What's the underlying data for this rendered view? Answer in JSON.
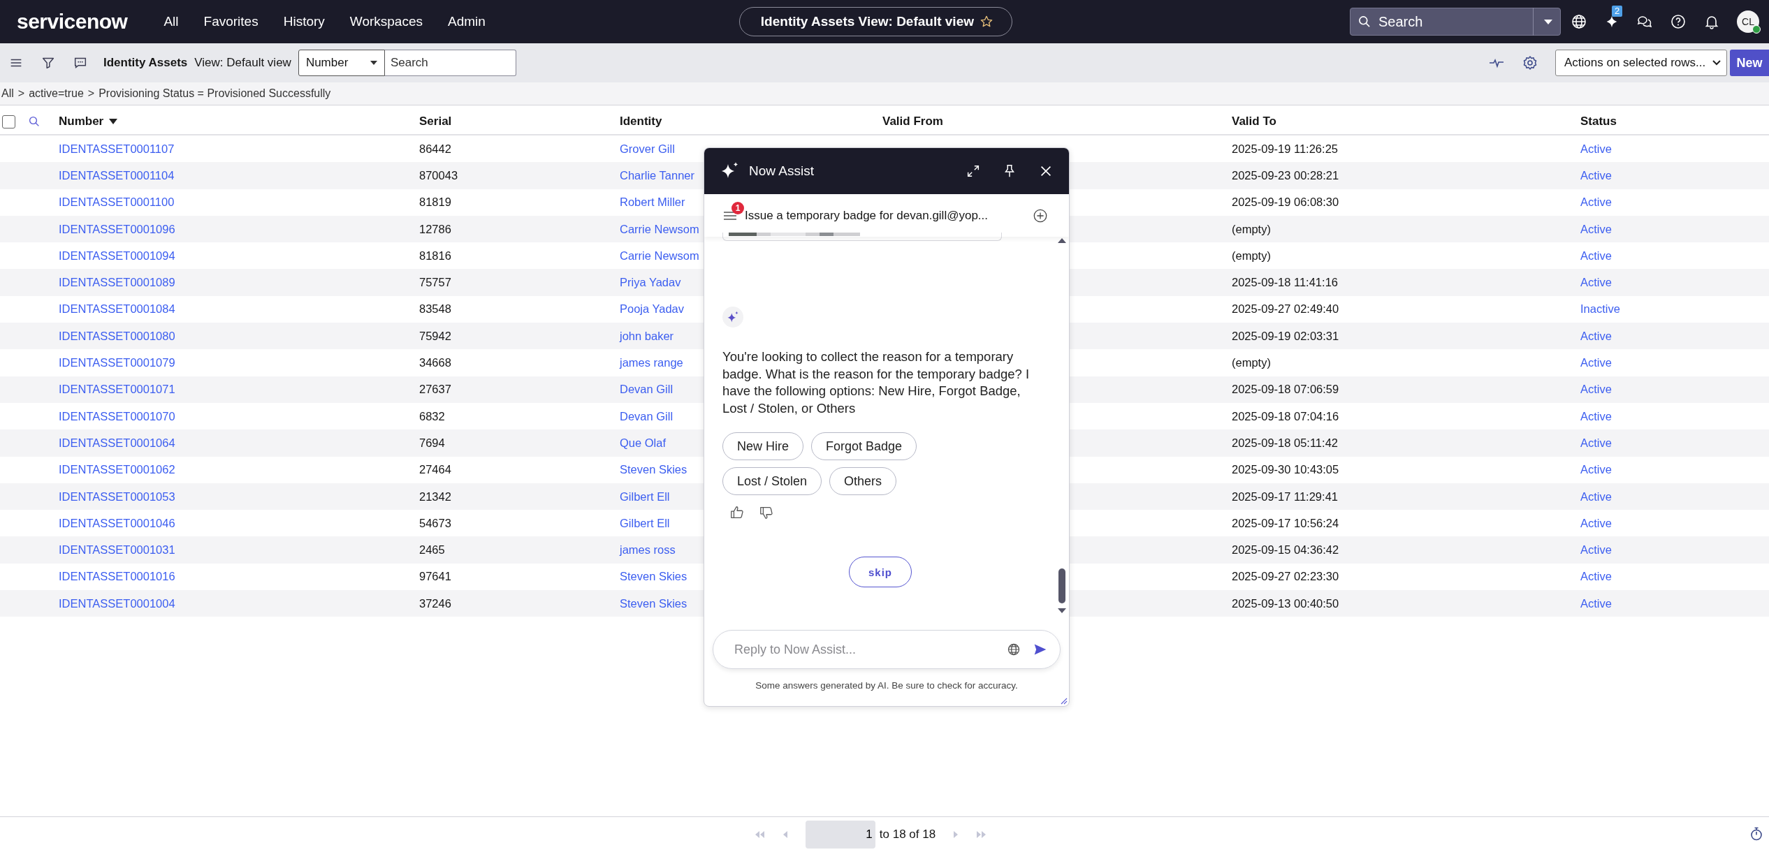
{
  "top_bar": {
    "logo": "servicenow",
    "nav": [
      "All",
      "Favorites",
      "History",
      "Workspaces",
      "Admin"
    ],
    "page_title": "Identity Assets View: Default view",
    "search": {
      "placeholder": "Search"
    },
    "assist_badge": "2",
    "avatar": "CL"
  },
  "list_toolbar": {
    "title": "Identity Assets",
    "view": "View: Default view",
    "field_select": "Number",
    "search": {
      "placeholder": "Search"
    },
    "actions_select": "Actions on selected rows...",
    "new_button": "New"
  },
  "breadcrumbs": {
    "separator": ">",
    "items": [
      "All",
      "active=true",
      "Provisioning Status = Provisioned Successfully"
    ]
  },
  "table": {
    "select_all_checked": false,
    "columns": [
      "Number",
      "Serial",
      "Identity",
      "Valid From",
      "Valid To",
      "Status"
    ],
    "rows": [
      {
        "number": "IDENTASSET0001107",
        "serial": "86442",
        "identity": "Grover Gill",
        "valid_to": "2025-09-19 11:26:25",
        "status": "Active"
      },
      {
        "number": "IDENTASSET0001104",
        "serial": "870043",
        "identity": "Charlie Tanner",
        "valid_to": "2025-09-23 00:28:21",
        "status": "Active"
      },
      {
        "number": "IDENTASSET0001100",
        "serial": "81819",
        "identity": "Robert Miller",
        "valid_to": "2025-09-19 06:08:30",
        "status": "Active"
      },
      {
        "number": "IDENTASSET0001096",
        "serial": "12786",
        "identity": "Carrie Newsom",
        "valid_to": "(empty)",
        "status": "Active"
      },
      {
        "number": "IDENTASSET0001094",
        "serial": "81816",
        "identity": "Carrie Newsom",
        "valid_to": "(empty)",
        "status": "Active"
      },
      {
        "number": "IDENTASSET0001089",
        "serial": "75757",
        "identity": "Priya Yadav",
        "valid_to": "2025-09-18 11:41:16",
        "status": "Active"
      },
      {
        "number": "IDENTASSET0001084",
        "serial": "83548",
        "identity": "Pooja Yadav",
        "valid_to": "2025-09-27 02:49:40",
        "status": "Inactive"
      },
      {
        "number": "IDENTASSET0001080",
        "serial": "75942",
        "identity": "john baker",
        "valid_to": "2025-09-19 02:03:31",
        "status": "Active"
      },
      {
        "number": "IDENTASSET0001079",
        "serial": "34668",
        "identity": "james range",
        "valid_to": "(empty)",
        "status": "Active"
      },
      {
        "number": "IDENTASSET0001071",
        "serial": "27637",
        "identity": "Devan Gill",
        "valid_to": "2025-09-18 07:06:59",
        "status": "Active"
      },
      {
        "number": "IDENTASSET0001070",
        "serial": "6832",
        "identity": "Devan Gill",
        "valid_to": "2025-09-18 07:04:16",
        "status": "Active"
      },
      {
        "number": "IDENTASSET0001064",
        "serial": "7694",
        "identity": "Que Olaf",
        "valid_to": "2025-09-18 05:11:42",
        "status": "Active"
      },
      {
        "number": "IDENTASSET0001062",
        "serial": "27464",
        "identity": "Steven Skies",
        "valid_to": "2025-09-30 10:43:05",
        "status": "Active"
      },
      {
        "number": "IDENTASSET0001053",
        "serial": "21342",
        "identity": "Gilbert Ell",
        "valid_to": "2025-09-17 11:29:41",
        "status": "Active"
      },
      {
        "number": "IDENTASSET0001046",
        "serial": "54673",
        "identity": "Gilbert Ell",
        "valid_to": "2025-09-17 10:56:24",
        "status": "Active"
      },
      {
        "number": "IDENTASSET0001031",
        "serial": "2465",
        "identity": "james ross",
        "valid_to": "2025-09-15 04:36:42",
        "status": "Active"
      },
      {
        "number": "IDENTASSET0001016",
        "serial": "97641",
        "identity": "Steven Skies",
        "valid_to": "2025-09-27 02:23:30",
        "status": "Active"
      },
      {
        "number": "IDENTASSET0001004",
        "serial": "37246",
        "identity": "Steven Skies",
        "valid_to": "2025-09-13 00:40:50",
        "status": "Active"
      }
    ]
  },
  "pagination": {
    "page_field": "1",
    "range": "to 18 of 18"
  },
  "assist_panel": {
    "title": "Now Assist",
    "conversation_title": "Issue a temporary badge for devan.gill@yop...",
    "unread_badge": "1",
    "message": "You're looking to collect the reason for a temporary badge. What is the reason for the temporary badge? I have the following options: New Hire, Forgot Badge, Lost / Stolen, or Others",
    "options": [
      "New Hire",
      "Forgot Badge",
      "Lost / Stolen",
      "Others"
    ],
    "skip_button": "skip",
    "reply": {
      "placeholder": "Reply to Now Assist..."
    },
    "disclaimer": "Some answers generated by AI. Be sure to check for accuracy."
  }
}
